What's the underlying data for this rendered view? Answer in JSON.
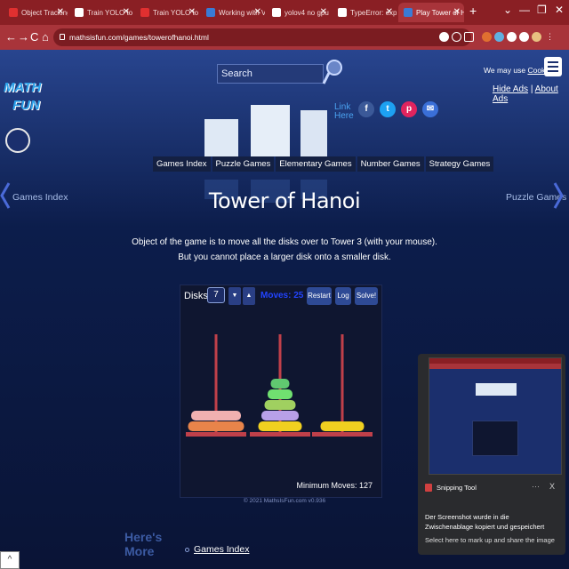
{
  "browser": {
    "tabs": [
      {
        "title": "Object Tracking fr",
        "icon_color": "#e03030"
      },
      {
        "title": "Train YOLO to dete",
        "icon_color": "#ffffff"
      },
      {
        "title": "Train YOLO to dete",
        "icon_color": "#e03030"
      },
      {
        "title": "Working with Vide",
        "icon_color": "#3a7bd5"
      },
      {
        "title": "yolov4 no gpu - Tr",
        "icon_color": "#ffffff"
      },
      {
        "title": "TypeError: expecte",
        "icon_color": "#ffffff"
      },
      {
        "title": "Play Tower of Han",
        "icon_color": "#3a7bd5"
      }
    ],
    "url": "mathsisfun.com/games/towerofhanoi.html",
    "new_tab_glyph": "+",
    "nav": {
      "back": "←",
      "forward": "→",
      "reload": "C",
      "home": "⌂"
    },
    "window": {
      "minimize": "—",
      "restore": "❐",
      "close": "✕",
      "dropdown": "⌄"
    }
  },
  "site": {
    "search_placeholder": "Search",
    "cookies_prefix": "We may use ",
    "cookies_link": "Cookies",
    "hide_ads": "Hide Ads",
    "about_ads": "About Ads",
    "separator": "|",
    "logo_line1": "MATH",
    "logo_line2": "FUN",
    "link_here": "Link Here",
    "nav_items": [
      "Games Index",
      "Puzzle Games",
      "Elementary Games",
      "Number Games",
      "Strategy Games"
    ],
    "prev_link": "Games Index",
    "next_link": "Puzzle Games",
    "title": "Tower of Hanoi",
    "desc_line1": "Object of the game is to move all the disks over to Tower 3 (with your mouse).",
    "desc_line2": "But you cannot place a larger disk onto a smaller disk."
  },
  "game": {
    "disks_label": "Disks:",
    "disks_value": "7",
    "down_arrow": "▼",
    "up_arrow": "▲",
    "moves_text": "Moves: 25",
    "restart": "Restart",
    "log": "Log",
    "solve": "Solve!",
    "min_moves": "Minimum Moves: 127",
    "copyright": "© 2021 MathsIsFun.com v0.936",
    "rod_color": "#c0404a",
    "base_color": "#c0404a",
    "towers": [
      [
        {
          "size": 7,
          "color": "#e8844a"
        },
        {
          "size": 6,
          "color": "#f0b0b0"
        }
      ],
      [
        {
          "size": 5,
          "color": "#f0d020"
        },
        {
          "size": 4,
          "color": "#b8a0e8"
        },
        {
          "size": 3,
          "color": "#a0d060"
        },
        {
          "size": 2,
          "color": "#70e070"
        },
        {
          "size": 1,
          "color": "#60c870"
        }
      ],
      [
        {
          "size": 5,
          "color": "#f0d020"
        }
      ]
    ]
  },
  "footer": {
    "art_text": "Here's\nMore",
    "games_index": "Games Index"
  },
  "snipping": {
    "app": "Snipping Tool",
    "more": "···",
    "close": "X",
    "message": "Der Screenshot wurde in die Zwischenablage kopiert und gespeichert",
    "sub": "Select here to mark up and share the image"
  },
  "scroll_up": "^"
}
